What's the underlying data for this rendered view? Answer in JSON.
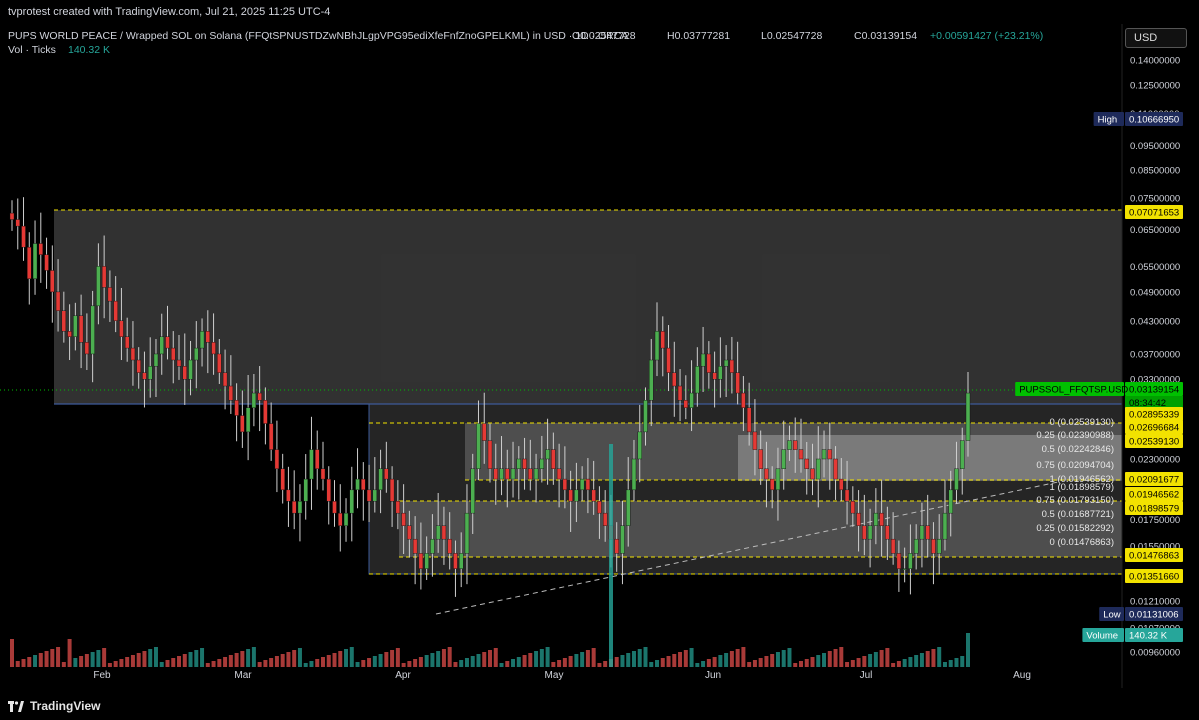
{
  "header": {
    "credit": "tvprotest created with TradingView.com, Jul 21, 2025 11:25 UTC-4",
    "symbol_line": "PUPS WORLD PEACE / Wrapped SOL on Solana (FFQtSPNUSTDZwNBhJLgpVPG95ediXfeFnfZnoGPELKML) in USD · 1D · ORCA",
    "ohlc": {
      "O": "O0.02547728",
      "H": "H0.03777281",
      "L": "L0.02547728",
      "C": "C0.03139154",
      "change": "+0.00591427 (+23.21%)"
    },
    "vol_label": "Vol · Ticks",
    "vol_value": "140.32 K"
  },
  "currency_button": "USD",
  "footer": {
    "brand": "TradingView"
  },
  "colors": {
    "up": "#26a69a",
    "down": "#ef5350",
    "up_candle": "#4caf50",
    "down_candle": "#e53935",
    "accent": "#00c000",
    "fib_yellow": "#f2e200",
    "label_blue": "#1e2a5a"
  },
  "chart_data": {
    "type": "candlestick",
    "x_ticks": [
      "Feb",
      "Mar",
      "Apr",
      "May",
      "Jun",
      "Jul",
      "Aug"
    ],
    "y_ticks": [
      "0.14000000",
      "0.12500000",
      "0.11000000",
      "0.09500000",
      "0.08500000",
      "0.07500000",
      "0.06500000",
      "0.05500000",
      "0.04900000",
      "0.04300000",
      "0.03700000",
      "0.03300000",
      "0.02300000",
      "0.01750000",
      "0.01550000",
      "0.01210000",
      "0.01070000",
      "0.00960000"
    ],
    "price_labels": [
      {
        "prefix": "High",
        "value": "0.10666950",
        "type": "blue"
      },
      {
        "prefix": "",
        "value": "0.07071653",
        "type": "yellow"
      },
      {
        "prefix": "PUPSSOL_FFQTSP.USD",
        "value": "0.03139154",
        "sub": "08:34:42",
        "type": "green"
      },
      {
        "prefix": "",
        "value": "0.02895339",
        "type": "yellow"
      },
      {
        "prefix": "",
        "value": "0.02696684",
        "type": "yellow"
      },
      {
        "prefix": "",
        "value": "0.02539130",
        "type": "yellow"
      },
      {
        "prefix": "",
        "value": "0.02091677",
        "type": "yellow"
      },
      {
        "prefix": "",
        "value": "0.01946562",
        "type": "yellow"
      },
      {
        "prefix": "",
        "value": "0.01898579",
        "type": "yellow"
      },
      {
        "prefix": "",
        "value": "0.01476863",
        "type": "yellow"
      },
      {
        "prefix": "",
        "value": "0.01351660",
        "type": "yellow"
      },
      {
        "prefix": "Low",
        "value": "0.01131006",
        "type": "blue"
      },
      {
        "prefix": "Volume",
        "value": "140.32 K",
        "type": "teal"
      }
    ],
    "fib_upper": [
      {
        "level": "0",
        "text": "0 (0.02539130)"
      },
      {
        "level": "0.25",
        "text": "0.25 (0.02390988)"
      },
      {
        "level": "0.5",
        "text": "0.5 (0.02242846)"
      },
      {
        "level": "0.75",
        "text": "0.75 (0.02094704)"
      },
      {
        "level": "1",
        "text": "1 (0.01946562)"
      }
    ],
    "fib_lower": [
      {
        "level": "1",
        "text": "1 (0.01898579)"
      },
      {
        "level": "0.75",
        "text": "0.75 (0.01793150)"
      },
      {
        "level": "0.5",
        "text": "0.5 (0.01687721)"
      },
      {
        "level": "0.25",
        "text": "0.25 (0.01582292)"
      },
      {
        "level": "0",
        "text": "0 (0.01476863)"
      }
    ],
    "ohlc_closes": [
      0.068,
      0.066,
      0.06,
      0.052,
      0.061,
      0.058,
      0.054,
      0.049,
      0.045,
      0.041,
      0.04,
      0.044,
      0.039,
      0.037,
      0.046,
      0.055,
      0.05,
      0.047,
      0.043,
      0.04,
      0.038,
      0.036,
      0.034,
      0.033,
      0.035,
      0.037,
      0.04,
      0.038,
      0.036,
      0.035,
      0.033,
      0.036,
      0.038,
      0.041,
      0.039,
      0.037,
      0.034,
      0.032,
      0.03,
      0.028,
      0.026,
      0.029,
      0.031,
      0.03,
      0.027,
      0.024,
      0.022,
      0.02,
      0.019,
      0.018,
      0.019,
      0.021,
      0.024,
      0.022,
      0.021,
      0.019,
      0.018,
      0.017,
      0.018,
      0.02,
      0.021,
      0.02,
      0.019,
      0.02,
      0.022,
      0.021,
      0.019,
      0.018,
      0.017,
      0.016,
      0.015,
      0.014,
      0.015,
      0.016,
      0.017,
      0.016,
      0.015,
      0.014,
      0.015,
      0.018,
      0.022,
      0.027,
      0.025,
      0.022,
      0.021,
      0.022,
      0.021,
      0.022,
      0.023,
      0.022,
      0.021,
      0.022,
      0.023,
      0.024,
      0.022,
      0.021,
      0.02,
      0.019,
      0.02,
      0.021,
      0.02,
      0.019,
      0.018,
      0.017,
      0.016,
      0.015,
      0.017,
      0.02,
      0.023,
      0.026,
      0.03,
      0.036,
      0.041,
      0.038,
      0.034,
      0.032,
      0.03,
      0.029,
      0.031,
      0.035,
      0.037,
      0.034,
      0.033,
      0.035,
      0.036,
      0.034,
      0.031,
      0.029,
      0.026,
      0.024,
      0.022,
      0.021,
      0.02,
      0.022,
      0.024,
      0.025,
      0.024,
      0.023,
      0.022,
      0.021,
      0.023,
      0.024,
      0.023,
      0.021,
      0.02,
      0.019,
      0.018,
      0.017,
      0.016,
      0.017,
      0.018,
      0.017,
      0.016,
      0.015,
      0.014,
      0.014,
      0.015,
      0.016,
      0.017,
      0.016,
      0.015,
      0.016,
      0.018,
      0.02,
      0.022,
      0.025,
      0.031
    ]
  }
}
